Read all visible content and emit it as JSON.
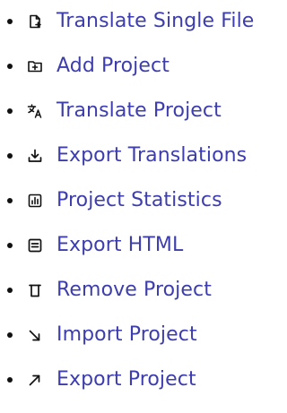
{
  "menu": {
    "items": [
      {
        "label": "Translate Single File",
        "icon": "file-plus-icon"
      },
      {
        "label": "Add Project",
        "icon": "folder-plus-icon"
      },
      {
        "label": "Translate Project",
        "icon": "translate-icon"
      },
      {
        "label": "Export Translations",
        "icon": "download-icon"
      },
      {
        "label": "Project Statistics",
        "icon": "bar-chart-icon"
      },
      {
        "label": "Export HTML",
        "icon": "document-lines-icon"
      },
      {
        "label": "Remove Project",
        "icon": "trash-icon"
      },
      {
        "label": "Import Project",
        "icon": "arrow-down-right-icon"
      },
      {
        "label": "Export Project",
        "icon": "arrow-up-right-icon"
      }
    ]
  },
  "colors": {
    "link": "#3d3dad",
    "bullet": "#111111",
    "icon": "#111111"
  }
}
